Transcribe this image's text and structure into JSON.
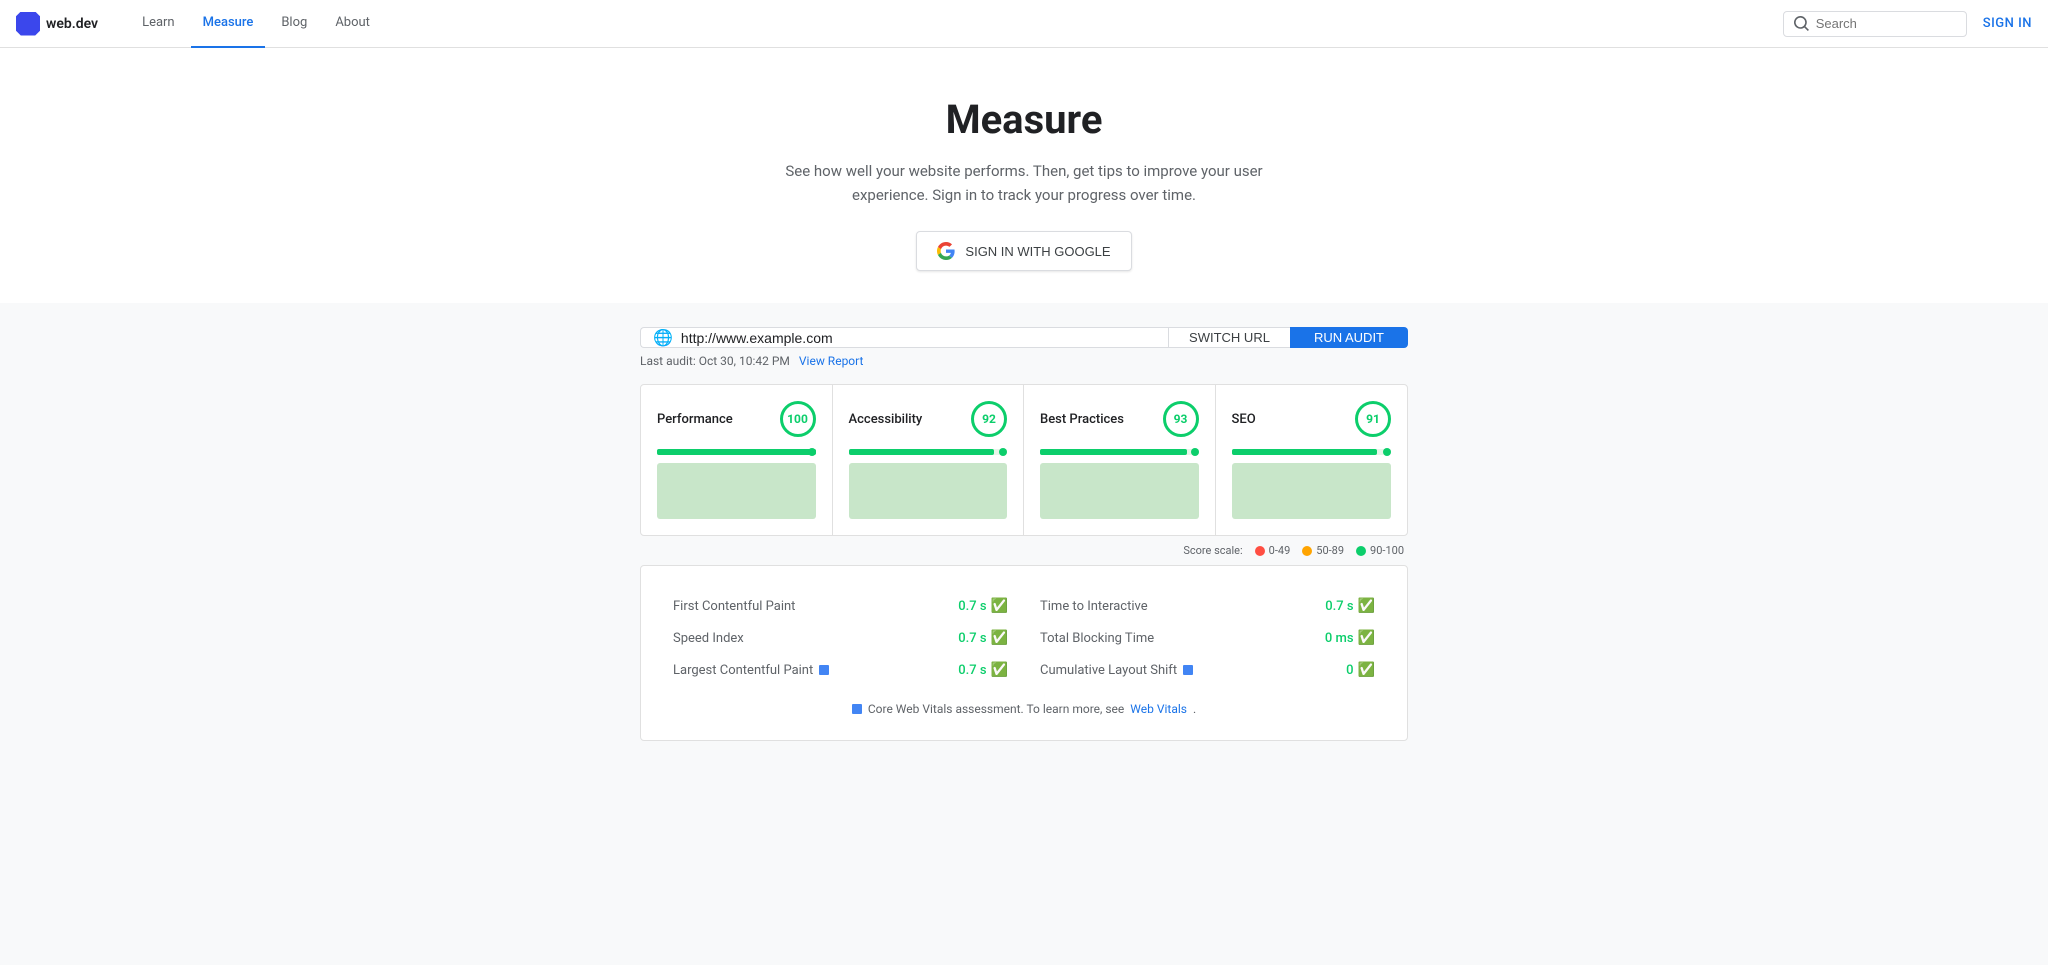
{
  "nav": {
    "logo_text": "web.dev",
    "links": [
      {
        "label": "Learn",
        "active": false
      },
      {
        "label": "Measure",
        "active": true
      },
      {
        "label": "Blog",
        "active": false
      },
      {
        "label": "About",
        "active": false
      }
    ],
    "search_placeholder": "Search",
    "sign_in": "SIGN IN"
  },
  "hero": {
    "title": "Measure",
    "description": "See how well your website performs. Then, get tips to improve your user experience. Sign in to track your progress over time.",
    "signin_btn": "SIGN IN WITH GOOGLE"
  },
  "url_section": {
    "url_value": "http://www.example.com",
    "switch_url": "SWITCH URL",
    "run_audit": "RUN AUDIT",
    "last_audit_label": "Last audit: Oct 30, 10:42 PM",
    "view_report": "View Report"
  },
  "scores": [
    {
      "label": "Performance",
      "value": "100",
      "bar_pct": 100
    },
    {
      "label": "Accessibility",
      "value": "92",
      "bar_pct": 92
    },
    {
      "label": "Best Practices",
      "value": "93",
      "bar_pct": 93
    },
    {
      "label": "SEO",
      "value": "91",
      "bar_pct": 91
    }
  ],
  "scale": {
    "label": "Score scale:",
    "items": [
      {
        "range": "0-49",
        "color": "#ff4e42"
      },
      {
        "range": "50-89",
        "color": "#ffa400"
      },
      {
        "range": "90-100",
        "color": "#0cce6b"
      }
    ]
  },
  "metrics": {
    "left": [
      {
        "name": "First Contentful Paint",
        "value": "0.7 s",
        "flag": false
      },
      {
        "name": "Speed Index",
        "value": "0.7 s",
        "flag": false
      },
      {
        "name": "Largest Contentful Paint",
        "value": "0.7 s",
        "flag": true
      }
    ],
    "right": [
      {
        "name": "Time to Interactive",
        "value": "0.7 s",
        "flag": false
      },
      {
        "name": "Total Blocking Time",
        "value": "0 ms",
        "flag": false
      },
      {
        "name": "Cumulative Layout Shift",
        "value": "0",
        "flag": true
      }
    ]
  },
  "cwv": {
    "note": "Core Web Vitals assessment. To learn more, see",
    "link_text": "Web Vitals",
    "link_href": "#"
  }
}
